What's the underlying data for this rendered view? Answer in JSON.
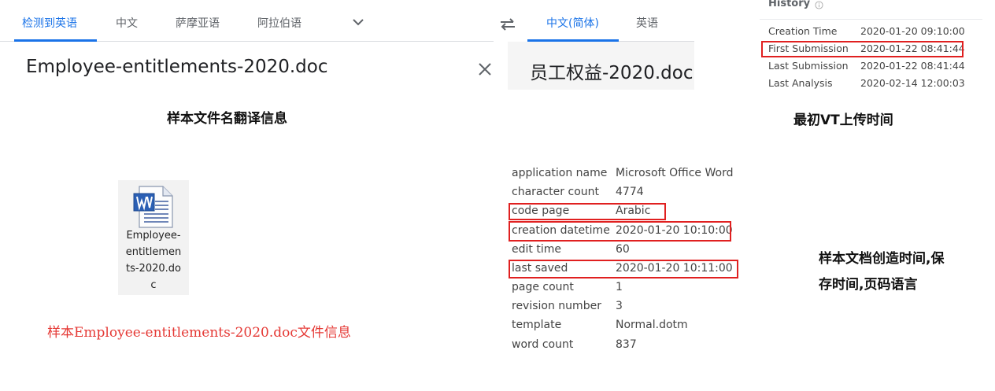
{
  "translator": {
    "source_tabs": [
      {
        "label": "检测到英语",
        "active": true
      },
      {
        "label": "中文",
        "active": false
      },
      {
        "label": "萨摩亚语",
        "active": false
      },
      {
        "label": "阿拉伯语",
        "active": false
      }
    ],
    "target_tabs": [
      {
        "label": "中文(简体)",
        "active": true
      },
      {
        "label": "英语",
        "active": false
      }
    ],
    "source_text": "Employee-entitlements-2020.doc",
    "target_text": "员工权益-2020.doc",
    "accent_color": "#1a73e8"
  },
  "history": {
    "title": "History",
    "rows": [
      {
        "label": "Creation Time",
        "value": "2020-01-20 09:10:00"
      },
      {
        "label": "First Submission",
        "value": "2020-01-22 08:41:44"
      },
      {
        "label": "Last Submission",
        "value": "2020-01-22 08:41:44"
      },
      {
        "label": "Last Analysis",
        "value": "2020-02-14 12:00:03"
      }
    ]
  },
  "captions": {
    "filename_translation": "样本文件名翻译信息",
    "first_vt_upload": "最初VT上传时间",
    "doc_meta_line1": "样本文档创造时间,保",
    "doc_meta_line2": "存时间,页码语言",
    "file_info": "样本Employee-entitlements-2020.doc文件信息"
  },
  "file": {
    "icon": "word-document-icon",
    "name_lines": [
      "Employee-",
      "entitlemen",
      "ts-2020.do",
      "c"
    ]
  },
  "properties": [
    {
      "label": "application name",
      "value": "Microsoft Office Word"
    },
    {
      "label": "character count",
      "value": "4774"
    },
    {
      "label": "code page",
      "value": "Arabic"
    },
    {
      "label": "creation datetime",
      "value": "2020-01-20 10:10:00"
    },
    {
      "label": "edit time",
      "value": "60"
    },
    {
      "label": "last saved",
      "value": "2020-01-20 10:11:00"
    },
    {
      "label": "page count",
      "value": "1"
    },
    {
      "label": "revision number",
      "value": "3"
    },
    {
      "label": "template",
      "value": "Normal.dotm"
    },
    {
      "label": "word count",
      "value": "837"
    }
  ],
  "highlight_color": "#e02020"
}
